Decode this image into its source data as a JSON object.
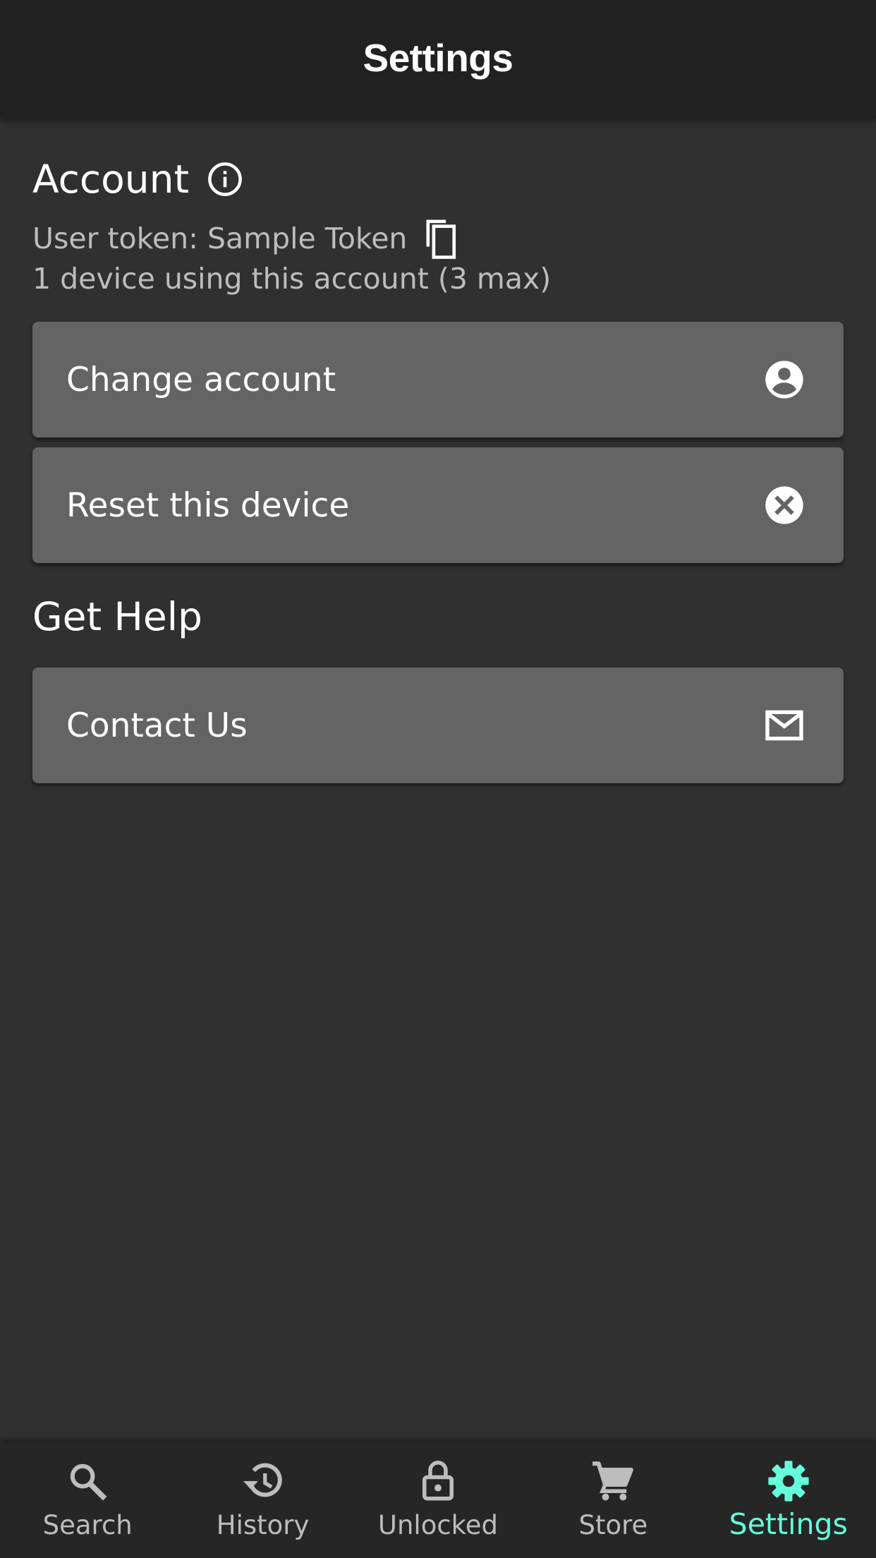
{
  "app_bar": {
    "title": "Settings"
  },
  "account": {
    "heading": "Account",
    "info_icon": "info-circle-icon",
    "token_line": "User token: Sample Token",
    "copy_icon": "copy-icon",
    "devices_line": "1 device using this account (3 max)",
    "actions": [
      {
        "label": "Change account",
        "icon": "account-circle-icon"
      },
      {
        "label": "Reset this device",
        "icon": "cancel-circle-icon"
      }
    ]
  },
  "help": {
    "heading": "Get Help",
    "actions": [
      {
        "label": "Contact Us",
        "icon": "mail-icon"
      }
    ]
  },
  "bottom_nav": {
    "active": "Settings",
    "items": [
      {
        "label": "Search",
        "icon": "search-icon"
      },
      {
        "label": "History",
        "icon": "history-icon"
      },
      {
        "label": "Unlocked",
        "icon": "unlocked-icon"
      },
      {
        "label": "Store",
        "icon": "cart-icon"
      },
      {
        "label": "Settings",
        "icon": "gear-icon"
      }
    ]
  },
  "colors": {
    "background": "#303030",
    "app_bar": "#212121",
    "card": "#646464",
    "bottom_nav": "#262626",
    "accent": "#64ffda",
    "secondary_text": "#bdbdbd"
  }
}
